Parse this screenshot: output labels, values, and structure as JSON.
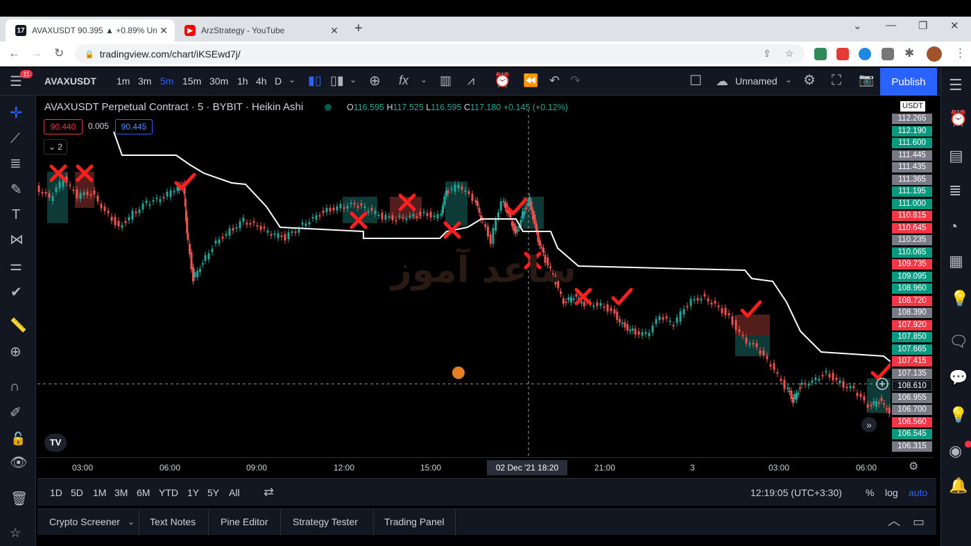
{
  "browser": {
    "tabs": [
      {
        "title": "AVAXUSDT 90.395 ▲ +0.89% Un",
        "favicon": "tradingview-icon",
        "active": true
      },
      {
        "title": "ArzStrategy - YouTube",
        "favicon": "youtube-icon",
        "active": false
      }
    ],
    "url": "tradingview.com/chart/iKSEwd7j/"
  },
  "toolbar": {
    "symbol": "AVAXUSDT",
    "intervals": [
      "1m",
      "3m",
      "5m",
      "15m",
      "30m",
      "1h",
      "4h",
      "D"
    ],
    "active_interval": "5m",
    "layout_name": "Unnamed",
    "publish_label": "Publish",
    "menu_badge": "11"
  },
  "legend": {
    "title": "AVAXUSDT Perpetual Contract · 5 · BYBIT · Heikin Ashi",
    "o_label": "O",
    "o": "116.595",
    "h_label": "H",
    "h": "117.525",
    "l_label": "L",
    "l": "116.595",
    "c_label": "C",
    "c": "117.180",
    "change": "+0.145 (+0.12%)",
    "bid": "90.440",
    "spread": "0.005",
    "ask": "90.445",
    "indicators_count": "2"
  },
  "price_axis": {
    "currency": "USDT",
    "labels": [
      {
        "text": "112.265",
        "color": "#787b86"
      },
      {
        "text": "112.190",
        "color": "#089981"
      },
      {
        "text": "111.600",
        "color": "#089981"
      },
      {
        "text": "111.445",
        "color": "#787b86"
      },
      {
        "text": "111.435",
        "color": "#787b86"
      },
      {
        "text": "111.365",
        "color": "#787b86"
      },
      {
        "text": "111.195",
        "color": "#089981"
      },
      {
        "text": "111.000",
        "color": "#089981"
      },
      {
        "text": "110.815",
        "color": "#f23645"
      },
      {
        "text": "110.645",
        "color": "#f23645"
      },
      {
        "text": "110.235",
        "color": "#787b86"
      },
      {
        "text": "110.065",
        "color": "#089981"
      },
      {
        "text": "109.735",
        "color": "#f23645"
      },
      {
        "text": "109.095",
        "color": "#089981"
      },
      {
        "text": "108.960",
        "color": "#089981"
      },
      {
        "text": "108.720",
        "color": "#f23645"
      },
      {
        "text": "108.390",
        "color": "#787b86"
      },
      {
        "text": "107.920",
        "color": "#f23645"
      },
      {
        "text": "107.850",
        "color": "#089981"
      },
      {
        "text": "107.665",
        "color": "#089981"
      },
      {
        "text": "107.415",
        "color": "#f23645"
      },
      {
        "text": "107.135",
        "color": "#787b86"
      },
      {
        "text": "108.610",
        "color": "#131722"
      },
      {
        "text": "106.955",
        "color": "#787b86"
      },
      {
        "text": "106.700",
        "color": "#787b86"
      },
      {
        "text": "106.560",
        "color": "#f23645"
      },
      {
        "text": "106.545",
        "color": "#089981"
      },
      {
        "text": "106.315",
        "color": "#787b86"
      }
    ]
  },
  "time_axis": {
    "labels": [
      "03:00",
      "06:00",
      "09:00",
      "12:00",
      "15:00",
      "18:20",
      "21:00",
      "3",
      "03:00",
      "06:00"
    ],
    "cursor_label": "02 Dec '21   18:20"
  },
  "range_bar": {
    "ranges": [
      "1D",
      "5D",
      "1M",
      "3M",
      "6M",
      "YTD",
      "1Y",
      "5Y",
      "All"
    ],
    "clock": "12:19:05 (UTC+3:30)",
    "percent": "%",
    "log": "log",
    "auto": "auto"
  },
  "bottom_tabs": [
    "Crypto Screener",
    "Text Notes",
    "Pine Editor",
    "Strategy Tester",
    "Trading Panel"
  ],
  "watermark": "ساعد آموز",
  "colors": {
    "bull": "#26a69a",
    "bear": "#ef5350",
    "accent": "#2962ff",
    "mark": "#ff1f1f"
  }
}
